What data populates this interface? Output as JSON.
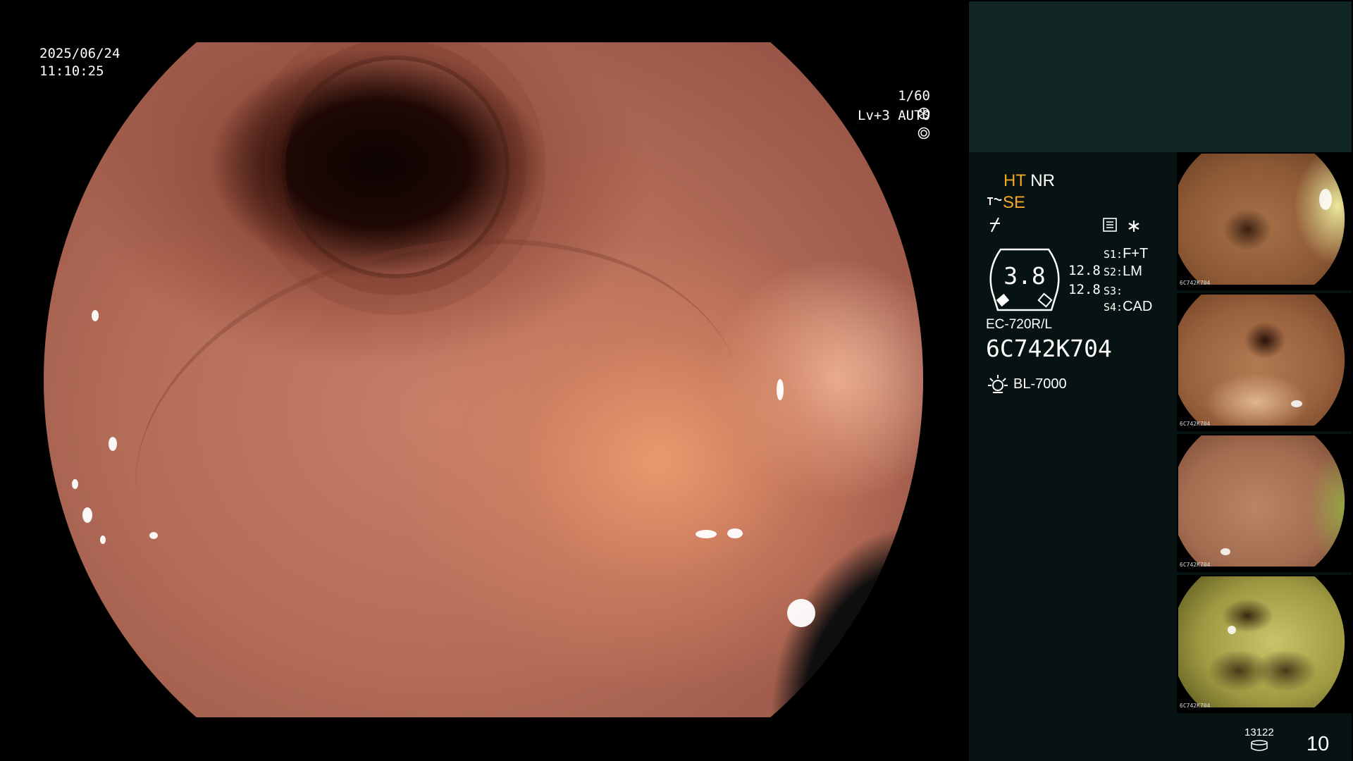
{
  "osd": {
    "date": "2025/06/24",
    "time": "11:10:25",
    "shutter": "1/60",
    "iris": "Lv+3 AUTO"
  },
  "modes": {
    "ht": "HT",
    "nr": "NR",
    "se": "SE"
  },
  "gauge": {
    "value": "3.8",
    "readout_top": "12.8",
    "readout_bottom": "12.8"
  },
  "presets": [
    {
      "key": "S1:",
      "value": "F+T"
    },
    {
      "key": "S2:",
      "value": "LM"
    },
    {
      "key": "S3:",
      "value": ""
    },
    {
      "key": "S4:",
      "value": "CAD"
    }
  ],
  "scope": {
    "model": "EC-720R/L",
    "serial": "6C742K704",
    "light_source": "BL-7000"
  },
  "thumbnails": [
    {
      "caption": "6C742K704"
    },
    {
      "caption": "6C742K704"
    },
    {
      "caption": "6C742K704"
    },
    {
      "caption": "6C742K704"
    }
  ],
  "footer": {
    "storage_count": "13122",
    "image_count": "10"
  },
  "colors": {
    "panel_header": "#0f2624",
    "panel_body": "#061312",
    "mode_active": "#f5a623"
  },
  "icons": [
    "shutter-icon",
    "iris-icon",
    "se-mode-icon",
    "filter-icon",
    "record-icon",
    "asterisk-icon",
    "light-source-icon",
    "storage-icon"
  ]
}
